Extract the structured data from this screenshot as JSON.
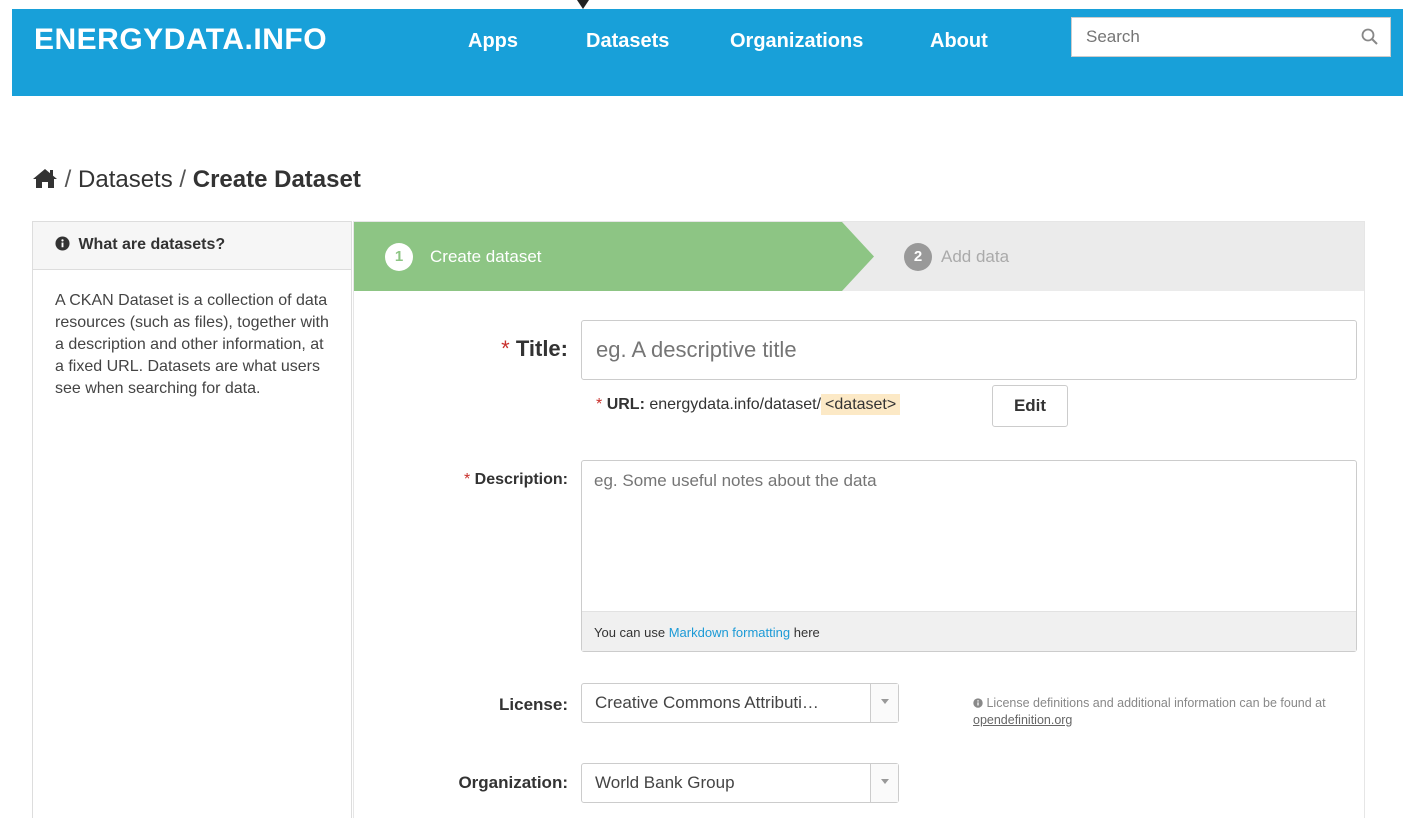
{
  "navbar": {
    "brand": "ENERGYDATA.INFO",
    "links": [
      "Apps",
      "Datasets",
      "Organizations",
      "About"
    ],
    "search_placeholder": "Search",
    "bg_color": "#18a0d9"
  },
  "breadcrumb": {
    "home_icon": "home-icon",
    "items": [
      "Datasets"
    ],
    "current": "Create Dataset",
    "separator": "/"
  },
  "sidebar": {
    "heading": "What are datasets?",
    "heading_icon": "info-circle-icon",
    "body": "A CKAN Dataset is a collection of data resources (such as files), together with a description and other information, at a fixed URL. Datasets are what users see when searching for data."
  },
  "stages": [
    {
      "number": "1",
      "label": "Create dataset",
      "active": true,
      "color": "#8dc584"
    },
    {
      "number": "2",
      "label": "Add data",
      "active": false,
      "color": "#999999"
    }
  ],
  "form": {
    "required_marker": "*",
    "title": {
      "label": "Title:",
      "placeholder": "eg. A descriptive title",
      "value": ""
    },
    "url": {
      "label": "URL:",
      "prefix": "energydata.info/dataset/",
      "slug": "<dataset>",
      "edit_label": "Edit"
    },
    "description": {
      "label": "Description:",
      "placeholder": "eg. Some useful notes about the data",
      "help_prefix": "You can use",
      "help_link": "Markdown formatting",
      "help_suffix": "here"
    },
    "license": {
      "label": "License:",
      "selected": "Creative Commons Attributi…",
      "help_text": "License definitions and additional information can be found at",
      "help_link": "opendefinition.org"
    },
    "organization": {
      "label": "Organization:",
      "selected": "World Bank Group"
    }
  }
}
